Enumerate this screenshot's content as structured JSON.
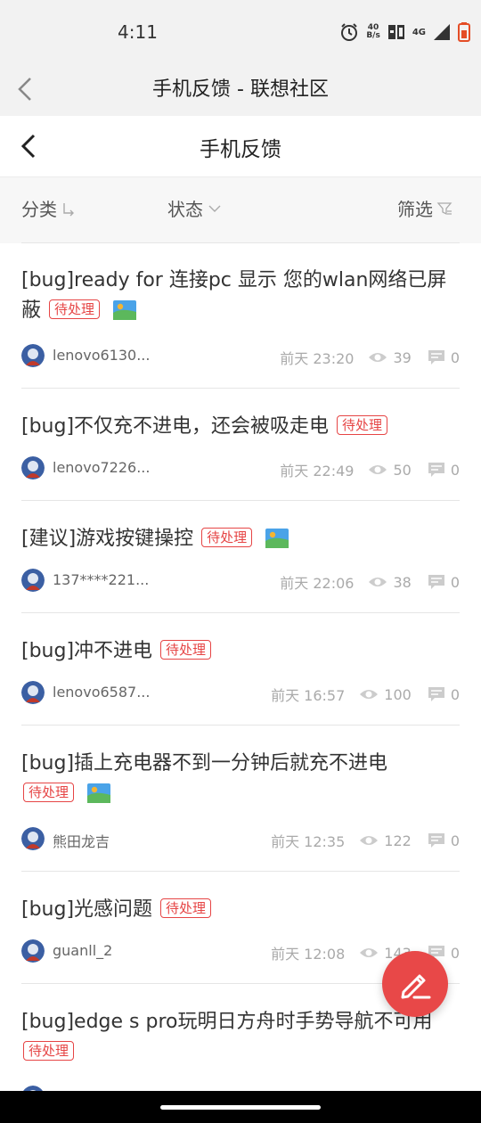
{
  "status_bar": {
    "time": "4:11",
    "speed_value": "40",
    "speed_unit": "B/s",
    "network": "4G"
  },
  "app_bar": {
    "title": "手机反馈 - 联想社区"
  },
  "page_header": {
    "title": "手机反馈"
  },
  "filters": {
    "category": "分类",
    "status": "状态",
    "filter": "筛选"
  },
  "posts": [
    {
      "title": "[bug]ready for 连接pc 显示 您的wlan网络已屏蔽",
      "tag": "待处理",
      "has_image": true,
      "author": "lenovo6130...",
      "time": "前天 23:20",
      "views": "39",
      "comments": "0"
    },
    {
      "title": "[bug]不仅充不进电，还会被吸走电",
      "tag": "待处理",
      "has_image": false,
      "author": "lenovo7226...",
      "time": "前天 22:49",
      "views": "50",
      "comments": "0"
    },
    {
      "title": "[建议]游戏按键操控",
      "tag": "待处理",
      "has_image": true,
      "author": "137****221...",
      "time": "前天 22:06",
      "views": "38",
      "comments": "0"
    },
    {
      "title": "[bug]冲不进电",
      "tag": "待处理",
      "has_image": false,
      "author": "lenovo6587...",
      "time": "前天 16:57",
      "views": "100",
      "comments": "0"
    },
    {
      "title": "[bug]插上充电器不到一分钟后就充不进电",
      "tag": "待处理",
      "has_image": true,
      "author": "熊田龙吉",
      "time": "前天 12:35",
      "views": "122",
      "comments": "0"
    },
    {
      "title": "[bug]光感问题",
      "tag": "待处理",
      "has_image": false,
      "author": "guanll_2",
      "time": "前天 12:08",
      "views": "143",
      "comments": "0"
    },
    {
      "title": "[bug]edge s pro玩明日方舟时手势导航不可用",
      "tag": "待处理",
      "has_image": false,
      "author": "",
      "time": "",
      "views": "",
      "comments": ""
    }
  ],
  "colors": {
    "accent": "#e84848",
    "tag": "#e64545"
  }
}
